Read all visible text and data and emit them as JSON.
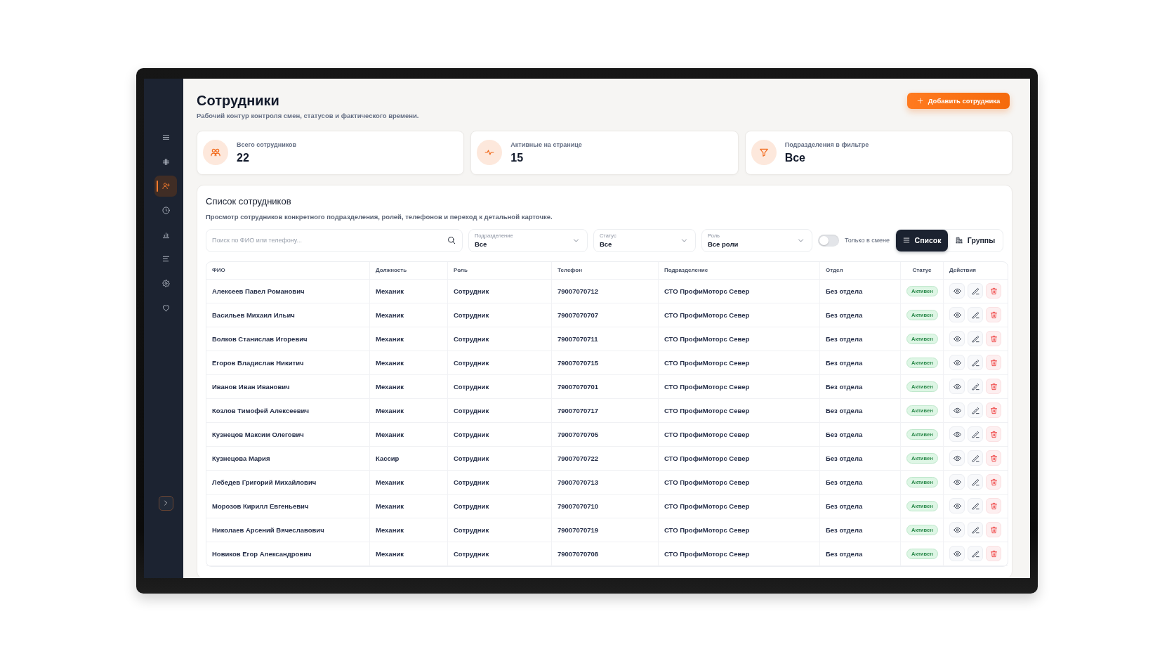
{
  "sidebar": {
    "items": [
      {
        "kind": "menu",
        "selected": false
      },
      {
        "kind": "grid",
        "selected": false
      },
      {
        "kind": "users",
        "selected": true
      },
      {
        "kind": "clock",
        "selected": false
      },
      {
        "kind": "chart",
        "selected": false
      },
      {
        "kind": "lines",
        "selected": false
      },
      {
        "kind": "settings",
        "selected": false
      },
      {
        "kind": "heart",
        "selected": false
      }
    ]
  },
  "header": {
    "title": "Сотрудники",
    "subtitle": "Рабочий контур контроля смен, статусов и фактического времени.",
    "add_button": "Добавить сотрудника"
  },
  "stats": [
    {
      "kind": "users",
      "label": "Всего сотрудников",
      "value": "22"
    },
    {
      "kind": "activity",
      "label": "Активные на странице",
      "value": "15"
    },
    {
      "kind": "filter",
      "label": "Подразделения в фильтре",
      "value": "Все"
    }
  ],
  "employee_list": {
    "title": "Список сотрудников",
    "description": "Просмотр сотрудников конкретного подразделения, ролей, телефонов и переход к детальной карточке.",
    "search": {
      "placeholder": "Поиск по ФИО или телефону..."
    },
    "filters": [
      {
        "label": "Подразделение",
        "value": "Все"
      },
      {
        "label": "Статус",
        "value": "Все"
      },
      {
        "label": "Роль",
        "value": "Все роли"
      }
    ],
    "shift_toggle": {
      "label": "Только в смене",
      "on": false
    },
    "view_modes": [
      {
        "kind": "list",
        "label": "Список",
        "selected": true
      },
      {
        "kind": "groups",
        "label": "Группы",
        "selected": false
      }
    ],
    "table": {
      "columns": [
        "ФИО",
        "Должность",
        "Роль",
        "Телефон",
        "Подразделение",
        "Отдел",
        "Статус",
        "Действия"
      ],
      "rows": [
        {
          "name": "Алексеев Павел Романович",
          "position": "Механик",
          "role": "Сотрудник",
          "phone": "79007070712",
          "subdivision": "СТО ПрофиМоторс Север",
          "department": "Без отдела",
          "status": "Активен"
        },
        {
          "name": "Васильев Михаил Ильич",
          "position": "Механик",
          "role": "Сотрудник",
          "phone": "79007070707",
          "subdivision": "СТО ПрофиМоторс Север",
          "department": "Без отдела",
          "status": "Активен"
        },
        {
          "name": "Волков Станислав Игоревич",
          "position": "Механик",
          "role": "Сотрудник",
          "phone": "79007070711",
          "subdivision": "СТО ПрофиМоторс Север",
          "department": "Без отдела",
          "status": "Активен"
        },
        {
          "name": "Егоров Владислав Никитич",
          "position": "Механик",
          "role": "Сотрудник",
          "phone": "79007070715",
          "subdivision": "СТО ПрофиМоторс Север",
          "department": "Без отдела",
          "status": "Активен"
        },
        {
          "name": "Иванов Иван Иванович",
          "position": "Механик",
          "role": "Сотрудник",
          "phone": "79007070701",
          "subdivision": "СТО ПрофиМоторс Север",
          "department": "Без отдела",
          "status": "Активен"
        },
        {
          "name": "Козлов Тимофей Алексеевич",
          "position": "Механик",
          "role": "Сотрудник",
          "phone": "79007070717",
          "subdivision": "СТО ПрофиМоторс Север",
          "department": "Без отдела",
          "status": "Активен"
        },
        {
          "name": "Кузнецов Максим Олегович",
          "position": "Механик",
          "role": "Сотрудник",
          "phone": "79007070705",
          "subdivision": "СТО ПрофиМоторс Север",
          "department": "Без отдела",
          "status": "Активен"
        },
        {
          "name": "Кузнецова Мария",
          "position": "Кассир",
          "role": "Сотрудник",
          "phone": "79007070722",
          "subdivision": "СТО ПрофиМоторс Север",
          "department": "Без отдела",
          "status": "Активен"
        },
        {
          "name": "Лебедев Григорий Михайлович",
          "position": "Механик",
          "role": "Сотрудник",
          "phone": "79007070713",
          "subdivision": "СТО ПрофиМоторс Север",
          "department": "Без отдела",
          "status": "Активен"
        },
        {
          "name": "Морозов Кирилл Евгеньевич",
          "position": "Механик",
          "role": "Сотрудник",
          "phone": "79007070710",
          "subdivision": "СТО ПрофиМоторс Север",
          "department": "Без отдела",
          "status": "Активен"
        },
        {
          "name": "Николаев Арсений Вячеславович",
          "position": "Механик",
          "role": "Сотрудник",
          "phone": "79007070719",
          "subdivision": "СТО ПрофиМоторс Север",
          "department": "Без отдела",
          "status": "Активен"
        },
        {
          "name": "Новиков Егор Александрович",
          "position": "Механик",
          "role": "Сотрудник",
          "phone": "79007070708",
          "subdivision": "СТО ПрофиМоторс Север",
          "department": "Без отдела",
          "status": "Активен"
        }
      ]
    }
  }
}
